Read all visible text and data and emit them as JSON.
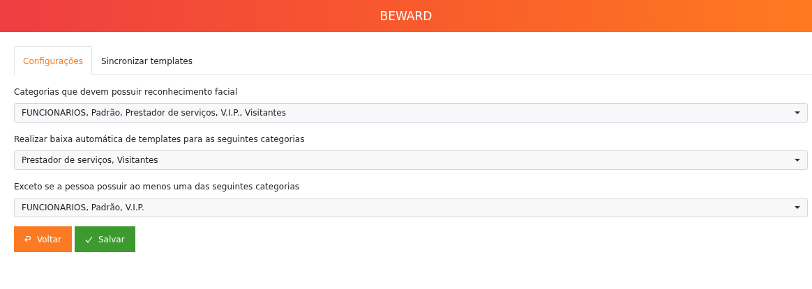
{
  "header": {
    "title": "BEWARD"
  },
  "tabs": [
    {
      "label": "Configurações",
      "selected": true
    },
    {
      "label": "Sincronizar templates",
      "selected": false
    }
  ],
  "fields": [
    {
      "label": "Categorias que devem possuir reconhecimento facial",
      "value": "FUNCIONARIOS, Padrão, Prestador de serviços, V.I.P., Visitantes"
    },
    {
      "label": "Realizar baixa automática de templates para as seguintes categorias",
      "value": "Prestador de serviços, Visitantes"
    },
    {
      "label": "Exceto se a pessoa possuir ao menos uma das seguintes categorias",
      "value": "FUNCIONARIOS, Padrão, V.I.P."
    }
  ],
  "buttons": [
    {
      "kind": "back",
      "label": "Voltar"
    },
    {
      "kind": "save",
      "label": "Salvar"
    }
  ]
}
